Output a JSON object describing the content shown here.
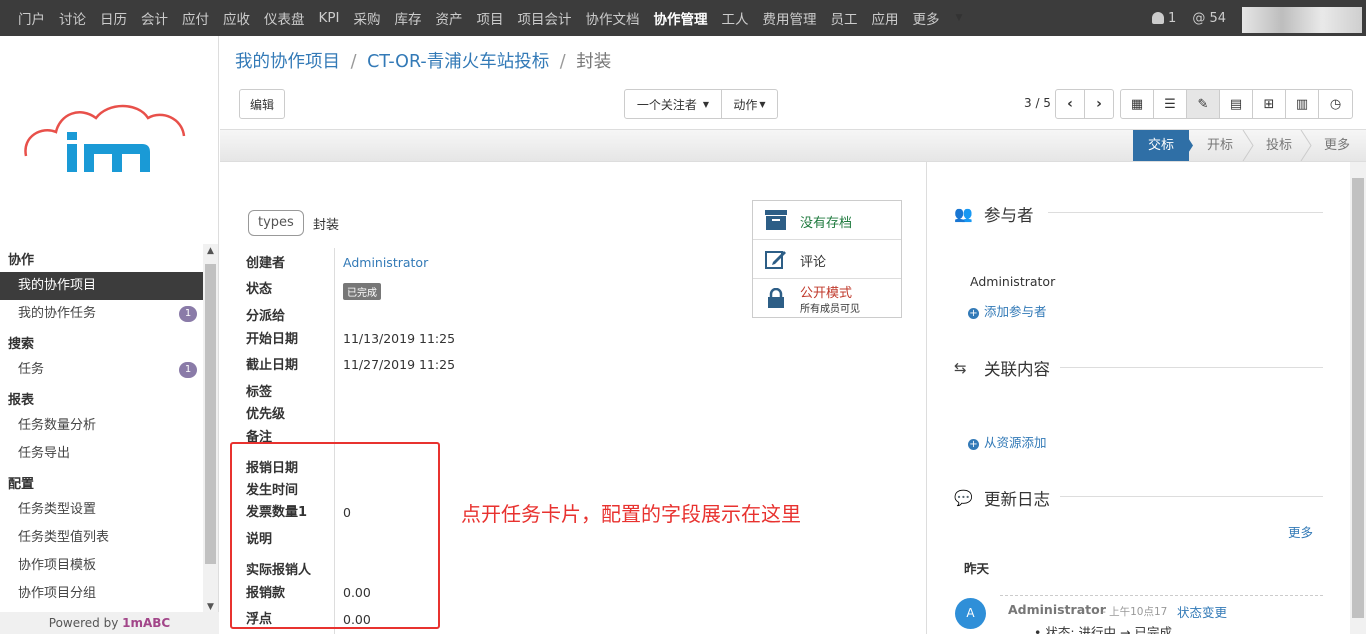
{
  "topnav": {
    "items": [
      "门户",
      "讨论",
      "日历",
      "会计",
      "应付",
      "应收",
      "仪表盘",
      "KPI",
      "采购",
      "库存",
      "资产",
      "项目",
      "项目会计",
      "协作文档",
      "协作管理",
      "工人",
      "费用管理",
      "员工",
      "应用",
      "更多"
    ],
    "active_index": 14,
    "notifications": "1",
    "mentions": "@ 54"
  },
  "sidebar": {
    "sections": [
      {
        "title": "协作",
        "items": [
          {
            "label": "我的协作项目",
            "active": true
          },
          {
            "label": "我的协作任务",
            "badge": "1"
          }
        ]
      },
      {
        "title": "搜索",
        "items": [
          {
            "label": "任务",
            "badge": "1"
          }
        ]
      },
      {
        "title": "报表",
        "items": [
          {
            "label": "任务数量分析"
          },
          {
            "label": "任务导出"
          }
        ]
      },
      {
        "title": "配置",
        "items": [
          {
            "label": "任务类型设置"
          },
          {
            "label": "任务类型值列表"
          },
          {
            "label": "协作项目模板"
          },
          {
            "label": "协作项目分组"
          }
        ]
      }
    ],
    "powered_prefix": "Powered by ",
    "powered_brand": "1mABC"
  },
  "breadcrumb": {
    "item1": "我的协作项目",
    "sep": "/",
    "item2": "CT-OR-青浦火车站投标",
    "current": "封装"
  },
  "toolbar": {
    "edit": "编辑",
    "followers": "一个关注者",
    "actions": "动作",
    "pager": "3 / 5"
  },
  "stages": [
    "交标",
    "开标",
    "投标",
    "更多"
  ],
  "form": {
    "types_tag": "types",
    "types_value": "封装",
    "fields": {
      "creator": {
        "label": "创建者",
        "value": "Administrator"
      },
      "status": {
        "label": "状态",
        "value": "已完成"
      },
      "assignee": {
        "label": "分派给"
      },
      "start": {
        "label": "开始日期",
        "value": "11/13/2019 11:25"
      },
      "deadline": {
        "label": "截止日期",
        "value": "11/27/2019 11:25"
      },
      "tags": {
        "label": "标签"
      },
      "priority": {
        "label": "优先级"
      },
      "notes": {
        "label": "备注"
      },
      "reimb_date": {
        "label": "报销日期"
      },
      "occur_time": {
        "label": "发生时间"
      },
      "invoice_qty": {
        "label": "发票数量1",
        "value": "0"
      },
      "desc": {
        "label": "说明"
      },
      "actual_person": {
        "label": "实际报销人"
      },
      "reimb_amount": {
        "label": "报销款",
        "value": "0.00"
      },
      "float": {
        "label": "浮点",
        "value": "0.00"
      }
    },
    "smart": {
      "archive": "没有存档",
      "comment": "评论",
      "public_title": "公开模式",
      "public_sub": "所有成员可见"
    },
    "annotation": "点开任务卡片，配置的字段展示在这里"
  },
  "chatter": {
    "participants_title": "参与者",
    "participant": "Administrator",
    "add_participant": "添加参与者",
    "related_title": "关联内容",
    "add_from_resource": "从资源添加",
    "log_title": "更新日志",
    "more": "更多",
    "yesterday": "昨天",
    "msg_author": "Administrator",
    "msg_time": "- 上午10点17",
    "msg_type": "状态变更",
    "msg_body": "• 状态: 进行中 → 已完成",
    "avatar_letter": "A"
  },
  "colors": {
    "accent": "#337ab7",
    "stage_current": "#2f6fa6",
    "annotation": "#e8322f",
    "badge": "#8a7ba8"
  }
}
